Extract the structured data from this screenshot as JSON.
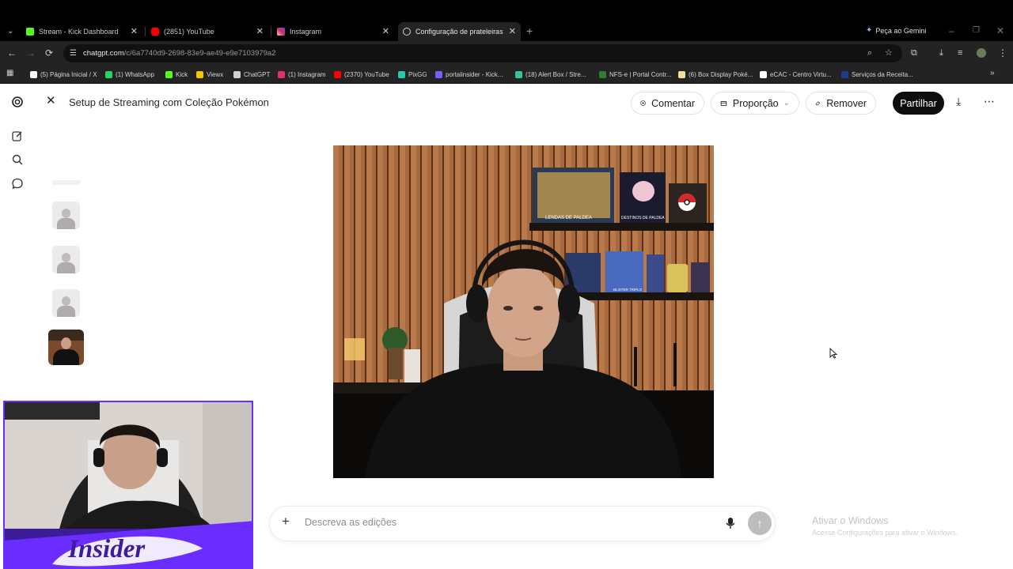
{
  "browser": {
    "tabs": [
      {
        "label": "Stream - Kick Dashboard",
        "icon": "kick-icon",
        "color": "#53fc18"
      },
      {
        "label": "(2851) YouTube",
        "icon": "youtube-icon",
        "color": "#ff0000"
      },
      {
        "label": "Instagram",
        "icon": "instagram-icon",
        "color": "#e1306c"
      },
      {
        "label": "Configuração de prateleiras Po",
        "icon": "chatgpt-icon",
        "color": "#cfcfcf"
      }
    ],
    "gemini_label": "Peça ao Gemini",
    "url_host": "chatgpt.com",
    "url_path": "/c/6a7740d9-2698-83e9-ae49-e9e7103979a2",
    "bookmarks": [
      {
        "label": "(5) Página Inicial / X",
        "color": "#ffffff"
      },
      {
        "label": "(1) WhatsApp",
        "color": "#25d366"
      },
      {
        "label": "Kick",
        "color": "#53fc18"
      },
      {
        "label": "Viewx",
        "color": "#f5c400"
      },
      {
        "label": "ChatGPT",
        "color": "#cfcfcf"
      },
      {
        "label": "(1) Instagram",
        "color": "#e1306c"
      },
      {
        "label": "(2370) YouTube",
        "color": "#ff0000"
      },
      {
        "label": "PixGG",
        "color": "#28c7a8"
      },
      {
        "label": "portalinsider - Kick...",
        "color": "#7a5cff"
      },
      {
        "label": "(18) Alert Box / Stre...",
        "color": "#31c3a2"
      },
      {
        "label": "NFS-e | Portal Contr...",
        "color": "#2e7d32"
      },
      {
        "label": "(6) Box Display Poké...",
        "color": "#f0e0a0"
      },
      {
        "label": "eCAC - Centro Virtu...",
        "color": "#ffffff"
      },
      {
        "label": "Serviços da Receita...",
        "color": "#1e3a8a"
      }
    ]
  },
  "header": {
    "title": "Setup de Streaming com Coleção Pokémon",
    "comment_label": "Comentar",
    "ratio_label": "Proporção",
    "remove_label": "Remover",
    "share_label": "Partilhar"
  },
  "shelf_labels": {
    "box_left": "LENDAS DE PALDEA",
    "box_right": "DESTINOS DE PALDEA",
    "blister": "BLISTER TRIPLO"
  },
  "input": {
    "placeholder": "Descreva as edições"
  },
  "windows_watermark": {
    "title": "Ativar o Windows",
    "subtitle": "Acesse Configurações para ativar o Windows."
  },
  "overlay": {
    "brand": "Insider"
  },
  "colors": {
    "share_bg": "#0d0d0d",
    "overlay_purple": "#6a2cff",
    "send_button": "#bdbdbd"
  }
}
